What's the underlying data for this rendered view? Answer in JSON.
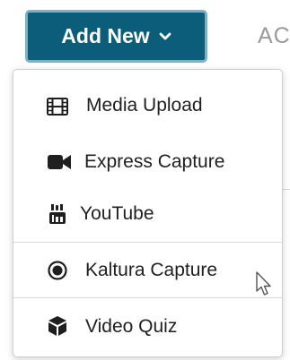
{
  "header": {
    "add_new_label": "Add New",
    "add_new_icon": "chevron-down-icon",
    "next_tab_partial": "AC"
  },
  "menu": {
    "items": [
      {
        "label": "Media Upload",
        "icon": "film-icon"
      },
      {
        "label": "Express Capture",
        "icon": "video-camera-icon"
      },
      {
        "label": "YouTube",
        "icon": "youtube-icon"
      },
      {
        "label": "Kaltura Capture",
        "icon": "record-icon"
      },
      {
        "label": "Video Quiz",
        "icon": "cube-icon"
      }
    ]
  },
  "colors": {
    "button_bg": "#0c5d7a",
    "button_border": "#7fb1c4",
    "menu_text": "#1f1f1f",
    "divider": "#d9d9d9"
  }
}
